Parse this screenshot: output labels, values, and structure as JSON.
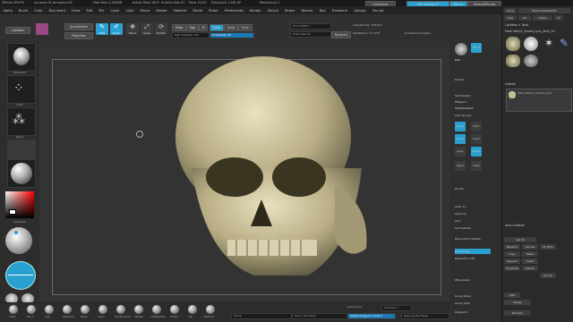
{
  "title_bar": {
    "items": [
      "ZBrush 4R6 P2",
      "sd_icons 01 Armadura 01",
      "Free Mem 2.526GB",
      "Active Mem 1613",
      "Scratch Disk 67",
      "Timer 0.015",
      "PolyCount 1.182 KP",
      "MeshCount 1"
    ],
    "right": [
      "QuickSave",
      "See-through 0",
      "Menus",
      "DefaultZScript"
    ]
  },
  "menu": [
    "Alpha",
    "Brush",
    "Color",
    "Document",
    "Draw",
    "Edit",
    "File",
    "Layer",
    "Light",
    "Macro",
    "Marker",
    "Material",
    "Movie",
    "Picker",
    "Preferences",
    "Render",
    "Stencil",
    "Stroke",
    "Texture",
    "Tool",
    "Transform",
    "Zplugin",
    "Zscript"
  ],
  "toolbar": {
    "lightbox": "LightBox",
    "quick_sketch_label": "QuickSketch",
    "projection_label": "Projection",
    "edit": "Edit",
    "draw": "Draw",
    "move": "Move",
    "scale": "Scale",
    "rotate": "Rotate",
    "mrgb": "Mrgb",
    "rgb": "Rgb",
    "m": "M",
    "rgb_intensity": "Rgb Intensity 100",
    "zadd": "Zadd",
    "zsub": "Zsub",
    "zcut": "Zcut",
    "z_intensity": "Z Intensity 25",
    "focal_shift": "Focal Shift 0",
    "draw_size": "Draw Size 64",
    "dynamic": "Dynamic",
    "active_points": "ActivePoints: 739,874",
    "total_points": "TotalPoints: 777,251",
    "activate_symmetry": "Activate Symmetry"
  },
  "left_shelf": {
    "tiles": [
      "Standard",
      "Dots",
      "Spray",
      "Alpha Off",
      "Texture Off",
      "SkinShade4"
    ],
    "gradient": "Gradient",
    "switch_color": "SwitchColor",
    "alternate": "Alternate"
  },
  "right_shelf": {
    "items": [
      "BPR",
      "SPix 3",
      "Scroll",
      "Zoom",
      "Actual",
      "AAHalf",
      "Dynamic",
      "Persp",
      "Floor",
      "Local",
      "L.Sym",
      "Gxyz",
      "Frame",
      "Move",
      "Scale",
      "Rotate",
      "Line Fill",
      "PolyF",
      "Transp",
      "Ghost",
      "Solo",
      "Xpose"
    ],
    "panel": [
      "Double",
      "Set Modeler",
      "PMSpect",
      "RestNewMesh",
      "Auto Groups",
      "Clear Fx",
      "Clear All",
      "Grid",
      "Symmetrize",
      "Divide",
      "Smt",
      "Suv",
      "ReUV",
      "Low",
      "High",
      "Del Lower",
      "Del Higher",
      "Reconstruct Subdiv",
      "Crease",
      "Group Panel",
      "Group Split",
      "Split to Parts",
      "Merge Visible",
      "Merge Down",
      "Dynamesh",
      "Resolution 128",
      "ZRemesher",
      "Target Polygons Count 5",
      "Adapt",
      "KeepGroups",
      "Polypaint",
      "Mask By Cavity"
    ],
    "labels": [
      "Sort Pts",
      "Bump",
      "Ply",
      "Lines",
      "Enable",
      "Uv",
      "PolyF"
    ]
  },
  "tray": {
    "top": [
      "Clone",
      "Make PolyMesh3D",
      "GoZ",
      "All",
      "Visible",
      "R"
    ],
    "lightbox_tools": "Lightbox > Tools",
    "tool_name": "Mesh Warp1_Scaled_Lynx_Skull_Hi...",
    "thumbs": [
      "Skull",
      "SphereBrushIA",
      "SimpleBrush",
      "PolyMesh3D",
      "Cylinder3D",
      "Mesh"
    ],
    "subtool": "Subtool",
    "subtool_items": [
      "Mesh Warp1_Scaled_Lynx"
    ],
    "lower_left": [
      "List All",
      "Rename",
      "All Low",
      "All High",
      "Copy",
      "Paste",
      "Append",
      "Insert",
      "Duplicate",
      "Delete",
      "Del Other",
      "Del All",
      "Split",
      "Merge",
      "Remesh",
      "Project",
      "Extract",
      "Mask"
    ],
    "auto_collapse": "Auto Collapse",
    "move_bar": "Move"
  },
  "bottom": {
    "brushes": [
      "Inflat",
      "Pinch",
      "Clay",
      "Standard",
      "Move",
      "Dam",
      "TrimDynamic",
      "hPolish",
      "ClayBuildup",
      "Stroke",
      "Clip",
      "MAHcut",
      "Morph"
    ],
    "labels": [
      "Sculptris",
      "Cur.Material",
      "Polyf",
      "DefMaterial",
      "ClayTubes"
    ],
    "mid": "Polish",
    "mid2": "Mirror and Weld",
    "right": [
      "AccuCurve",
      "Intensity 1",
      "Target Polygons Count 5",
      "Regroup By Edges"
    ]
  },
  "colors": {
    "accent": "#2aa0d0",
    "canvas": "#333333",
    "skull_main": "#c8bf9a"
  }
}
